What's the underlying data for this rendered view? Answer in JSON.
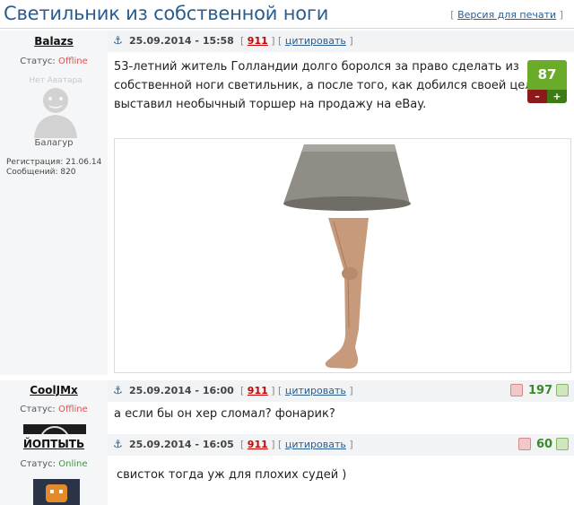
{
  "page": {
    "title": "Светильник из собственной ноги",
    "print_prefix": "[ ",
    "print_label": "Версия для печати",
    "print_suffix": " ]"
  },
  "posts": [
    {
      "author": "Balazs",
      "status_label": "Статус: ",
      "status_value": "Offline",
      "avatar_text": "Нет Аватара",
      "rank": "Балагур",
      "reg_label": "Регистрация: 21.06.14",
      "msgs_label": "Сообщений: 820",
      "date": "25.09.2014 - 15:58",
      "post_num": "911",
      "quote_label": "цитировать",
      "text_lines": [
        "53-летний житель Голландии долго боролся за право сделать из",
        "собственной ноги светильник, а после того, как добился своей цели,",
        "выставил необычный торшер на продажу на eBay."
      ],
      "rating": "87",
      "minus": "–",
      "plus": "+"
    },
    {
      "author": "CoolJMx",
      "status_label": "Статус: ",
      "status_value": "Offline",
      "date": "25.09.2014 - 16:00",
      "post_num": "911",
      "quote_label": "цитировать",
      "text": "а если бы он хер сломал? фонарик?",
      "rating": "197"
    },
    {
      "author": "ЙОПТЫТЬ",
      "status_label": "Статус: ",
      "status_value": "Online",
      "date": "25.09.2014 - 16:05",
      "post_num": "911",
      "quote_label": "цитировать",
      "text": "свисток тогда уж для плохих судей )",
      "rating": "60"
    }
  ],
  "colors": {
    "title": "#2a5d8f",
    "offline": "#d9534f",
    "online": "#3a9a3a",
    "rating_green": "#6aab2a"
  },
  "icons": [
    "anchor-icon",
    "no-avatar-icon",
    "thumb-down-icon",
    "thumb-up-icon",
    "minus-icon",
    "plus-icon"
  ]
}
